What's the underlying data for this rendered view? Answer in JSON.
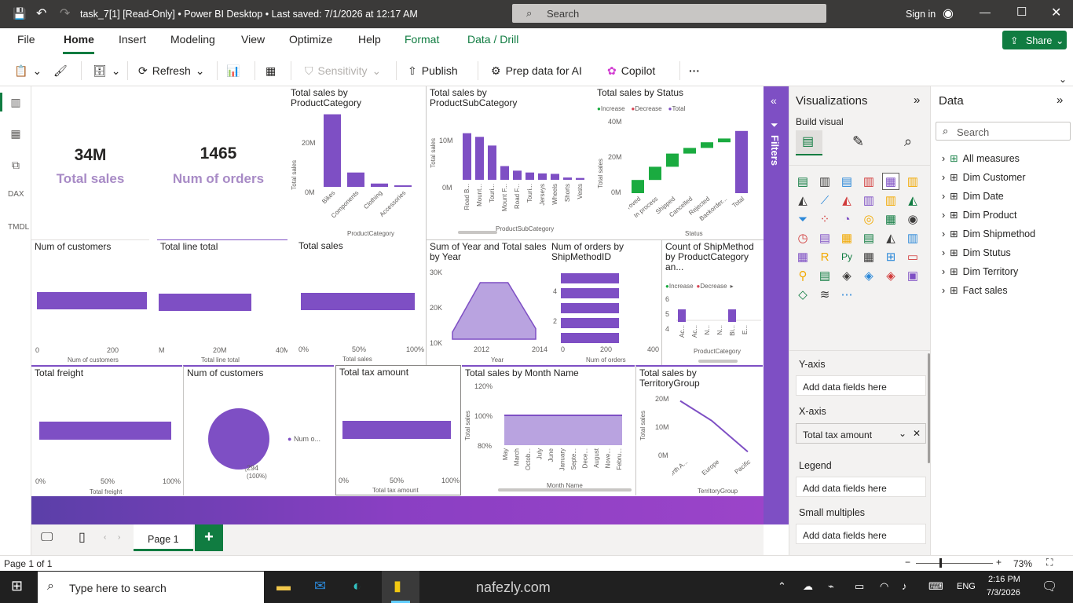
{
  "window": {
    "title": "task_7[1] [Read-Only] • Power BI Desktop • Last saved: 7/1/2026 at 12:17 AM",
    "search_placeholder": "Search",
    "sign_in": "Sign in"
  },
  "ribbon": {
    "tabs": [
      "File",
      "Home",
      "Insert",
      "Modeling",
      "View",
      "Optimize",
      "Help",
      "Format",
      "Data / Drill"
    ],
    "share_label": "Share",
    "tools": {
      "refresh": "Refresh",
      "sensitivity": "Sensitivity",
      "publish": "Publish",
      "prep_data": "Prep data for AI",
      "copilot": "Copilot",
      "more": "···"
    }
  },
  "filters_label": "Filters",
  "visuals": {
    "kpi_sales": {
      "value": "34M",
      "label": "Total sales"
    },
    "kpi_orders": {
      "value": "1465",
      "label": "Num of orders"
    },
    "prodcat": {
      "title": "Total sales by ProductCategory",
      "xlabel": "ProductCategory",
      "ylabel": "Total sales",
      "yticks": [
        "20M",
        "0M"
      ]
    },
    "subcat": {
      "title": "Total sales by ProductSubCategory",
      "xlabel": "ProductSubCategory",
      "ylabel": "Total sales",
      "yticks": [
        "10M",
        "0M"
      ]
    },
    "status": {
      "title": "Total sales by Status",
      "legend": [
        "Increase",
        "Decrease",
        "Total"
      ],
      "xlabel": "Status",
      "ylabel": "Total sales",
      "yticks": [
        "40M",
        "20M",
        "0M"
      ]
    },
    "customers_bar": {
      "title": "Num of customers",
      "xlabel": "Num of customers",
      "xticks": [
        "0",
        "200"
      ]
    },
    "linetotal_bar": {
      "title": "Total line total",
      "xlabel": "Total line total",
      "xticks": [
        "M",
        "20M",
        "40M"
      ]
    },
    "sales_bar": {
      "title": "Total sales",
      "xlabel": "Total sales",
      "xticks": [
        "0%",
        "50%",
        "100%"
      ]
    },
    "year_area": {
      "title": "Sum of Year and Total sales by Year",
      "xlabel": "Year",
      "yticks": [
        "30K",
        "20K",
        "10K"
      ],
      "xticks": [
        "2012",
        "2014"
      ]
    },
    "shipmethod": {
      "title": "Num of orders by ShipMethodID",
      "xlabel": "Num of orders",
      "yticks": [
        "4",
        "2"
      ],
      "xticks": [
        "0",
        "200",
        "400"
      ]
    },
    "ship_prodcat": {
      "title": "Count of ShipMethod by ProductCategory an...",
      "legend": [
        "Increase",
        "Decrease"
      ],
      "xlabel": "ProductCategory",
      "yticks": [
        "6",
        "5",
        "4"
      ]
    },
    "freight_bar": {
      "title": "Total freight",
      "xlabel": "Total freight",
      "xticks": [
        "0%",
        "50%",
        "100%"
      ]
    },
    "customers_pie": {
      "title": "Num of customers",
      "legend": "Num o...",
      "data_label": "294",
      "data_pct": "(100%)"
    },
    "tax_bar": {
      "title": "Total tax amount",
      "xlabel": "Total tax amount",
      "xticks": [
        "0%",
        "50%",
        "100%"
      ]
    },
    "month_area": {
      "title": "Total sales by Month Name",
      "xlabel": "Month Name",
      "ylabel": "Total sales",
      "yticks": [
        "120%",
        "100%",
        "80%"
      ]
    },
    "territory": {
      "title": "Total sales by TerritoryGroup",
      "xlabel": "TerritoryGroup",
      "ylabel": "Total sales",
      "yticks": [
        "20M",
        "10M",
        "0M"
      ]
    }
  },
  "chart_data": [
    {
      "type": "bar",
      "title": "Total sales by ProductCategory",
      "categories": [
        "Bikes",
        "Components",
        "Clothing",
        "Accessories"
      ],
      "values": [
        28.3,
        5.6,
        1.3,
        0.6
      ],
      "ylim": [
        0,
        30
      ]
    },
    {
      "type": "bar",
      "title": "Total sales by ProductSubCategory",
      "categories": [
        "Road B...",
        "Mount...",
        "Touri...",
        "Mount F...",
        "Road F...",
        "Touri...",
        "Jerseys",
        "Wheels",
        "Shorts",
        "Vests"
      ],
      "values": [
        10.2,
        9.4,
        7.5,
        3.0,
        2.0,
        1.6,
        1.4,
        1.3,
        0.5,
        0.4
      ],
      "ylim": [
        0,
        11
      ]
    },
    {
      "type": "bar",
      "title": "Total sales by Status",
      "categories": [
        "Approved",
        "In process",
        "Shipped",
        "Cancelled",
        "Rejected",
        "Backorder...",
        "Total"
      ],
      "values": [
        7,
        7,
        7,
        3,
        3,
        2,
        33
      ],
      "ylim": [
        0,
        40
      ]
    },
    {
      "type": "area",
      "title": "Sum of Year and Total sales by Year",
      "x": [
        "2011",
        "2012",
        "2013",
        "2014"
      ],
      "values": [
        12,
        26,
        26,
        13
      ],
      "ylim": [
        10,
        30
      ]
    },
    {
      "type": "bar",
      "title": "Num of orders by ShipMethodID",
      "categories": [
        "5",
        "4",
        "3",
        "2",
        "1"
      ],
      "values": [
        300,
        300,
        300,
        300,
        300
      ],
      "xlim": [
        0,
        400
      ]
    },
    {
      "type": "bar",
      "title": "Total sales by Month Name",
      "categories": [
        "May",
        "March",
        "Octob...",
        "July",
        "June",
        "January",
        "Septe...",
        "Dece...",
        "August",
        "Nove...",
        "Febru..."
      ],
      "values": [
        100,
        100,
        100,
        100,
        100,
        100,
        100,
        100,
        100,
        100,
        100
      ],
      "ylim": [
        80,
        120
      ]
    },
    {
      "type": "line",
      "title": "Total sales by TerritoryGroup",
      "categories": [
        "North A...",
        "Europe",
        "Pacific"
      ],
      "values": [
        19,
        12,
        1
      ],
      "ylim": [
        0,
        20
      ]
    },
    {
      "type": "pie",
      "title": "Num of customers",
      "categories": [
        "Num o..."
      ],
      "values": [
        294
      ]
    }
  ],
  "viz_pane": {
    "title": "Visualizations",
    "build_visual": "Build visual",
    "wells": [
      {
        "label": "Y-axis",
        "value": "Add data fields here"
      },
      {
        "label": "X-axis",
        "value": "Total tax amount"
      },
      {
        "label": "Legend",
        "value": "Add data fields here"
      },
      {
        "label": "Small multiples",
        "value": "Add data fields here"
      }
    ]
  },
  "data_pane": {
    "title": "Data",
    "search_placeholder": "Search",
    "tables": [
      "All measures",
      "Dim Customer",
      "Dim Date",
      "Dim Product",
      "Dim Shipmethod",
      "Dim Stutus",
      "Dim Territory",
      "Fact sales"
    ]
  },
  "page_tabs": {
    "current": "Page 1",
    "add": "+"
  },
  "status": {
    "page_info": "Page 1 of 1",
    "zoom": "73%"
  },
  "taskbar": {
    "search_placeholder": "Type here to search",
    "time": "2:16 PM",
    "date": "7/3/2026",
    "lang": "ENG",
    "watermark": "nafezly.com"
  }
}
